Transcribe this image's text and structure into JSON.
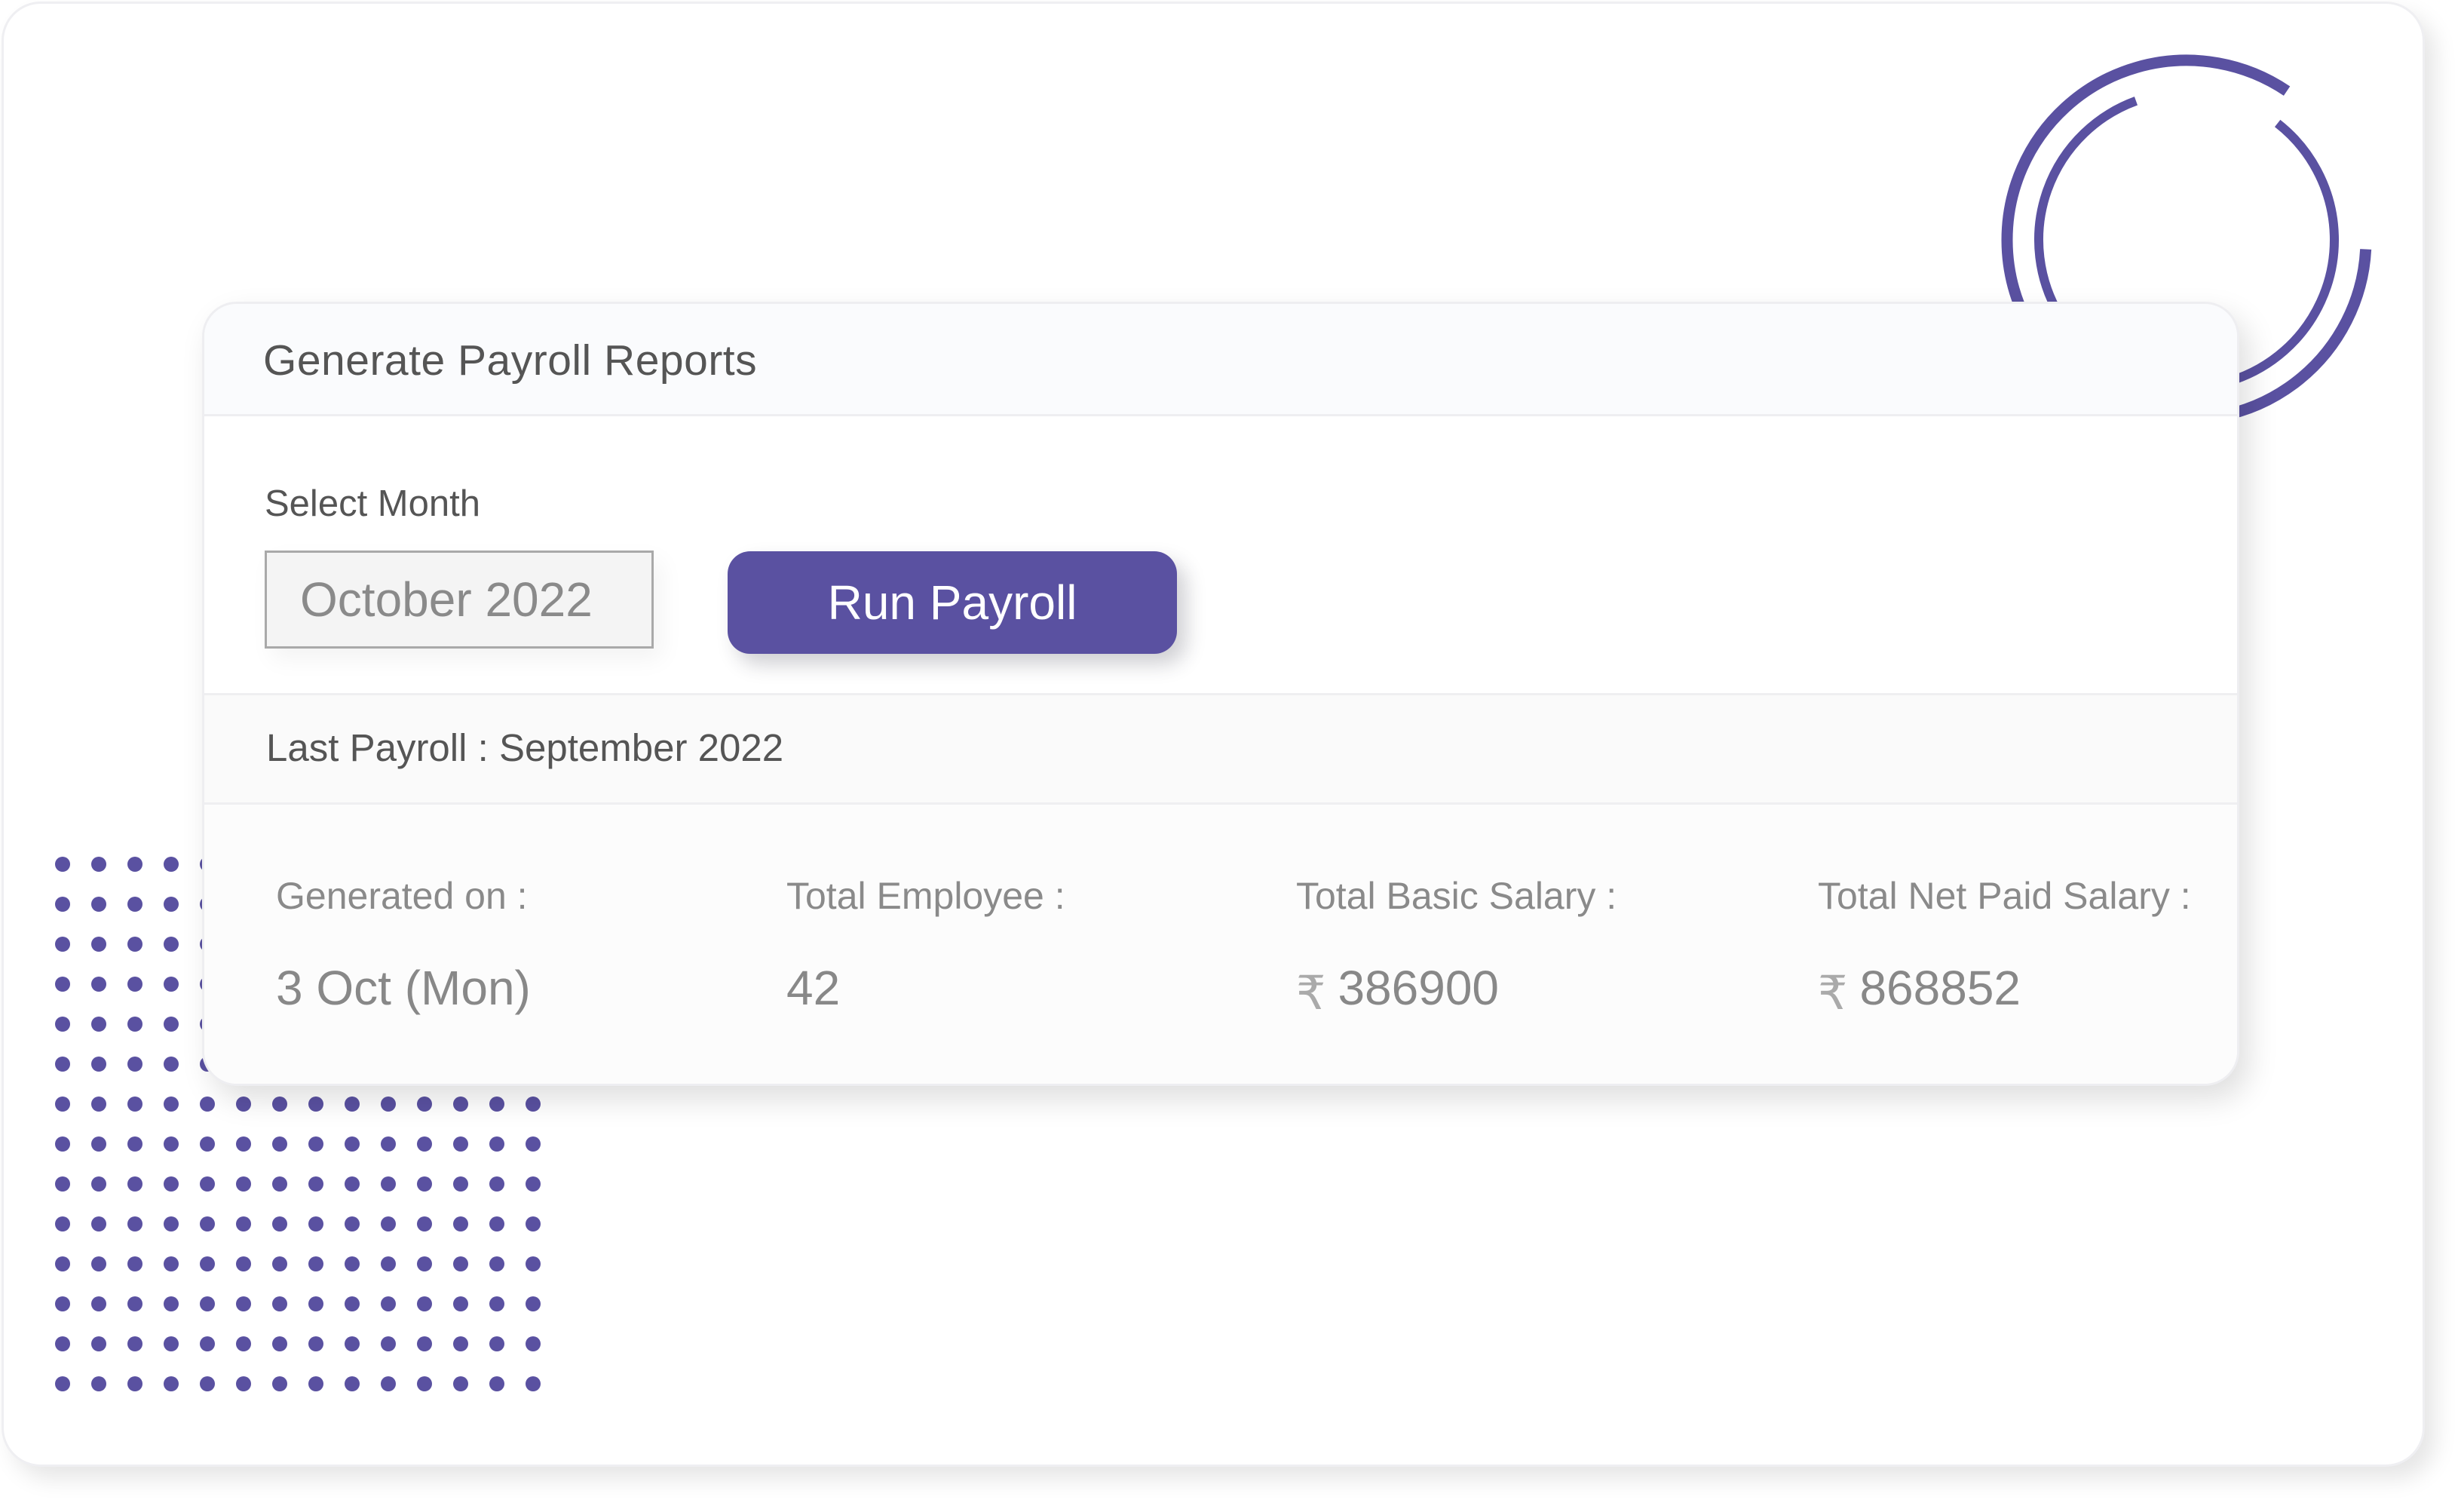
{
  "colors": {
    "accent": "#5a51a1",
    "title_text": "#555555",
    "muted_text": "#888888"
  },
  "card": {
    "title": "Generate Payroll Reports",
    "select_month_label": "Select Month",
    "month_input_value": "October 2022",
    "run_button_label": "Run Payroll",
    "last_payroll_text": "Last Payroll : September 2022"
  },
  "stats": [
    {
      "label": "Generated on :",
      "value": "3 Oct (Mon)",
      "currency": null
    },
    {
      "label": "Total Employee :",
      "value": "42",
      "currency": null
    },
    {
      "label": "Total Basic Salary :",
      "value": "386900",
      "currency": "₹"
    },
    {
      "label": "Total Net Paid Salary :",
      "value": "868852",
      "currency": "₹"
    }
  ],
  "decorations": {
    "ring_icon": "concentric-arc-rings",
    "dot_grid_icon": "dot-grid-pattern",
    "currency_icon": "rupee-icon"
  }
}
